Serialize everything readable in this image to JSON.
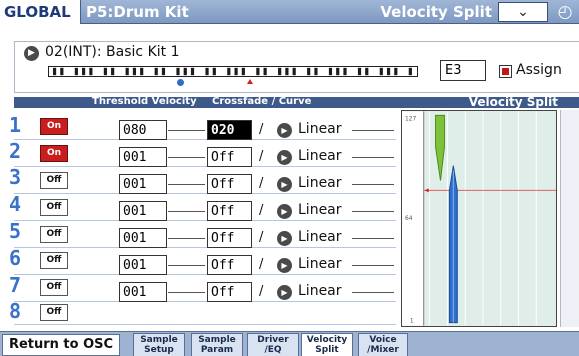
{
  "header": {
    "mode": "GLOBAL",
    "page": "P5:Drum Kit",
    "title": "Velocity Split",
    "menu_icon": "chevron-down-icon",
    "clock_icon": "clock-icon"
  },
  "program": {
    "name": "02(INT): Basic Kit 1",
    "note": "E3",
    "assign_label": "Assign",
    "assign_checked": true
  },
  "columns": {
    "threshold": "Threshold Velocity",
    "crossfade": "Crossfade / Curve",
    "graph": "Velocity Split"
  },
  "rows": [
    {
      "num": "1",
      "state": "On",
      "threshold": "080",
      "crossfade": "020",
      "slash": "/",
      "curve": "Linear"
    },
    {
      "num": "2",
      "state": "On",
      "threshold": "001",
      "crossfade": "Off",
      "slash": "/",
      "curve": "Linear"
    },
    {
      "num": "3",
      "state": "Off",
      "threshold": "001",
      "crossfade": "Off",
      "slash": "/",
      "curve": "Linear"
    },
    {
      "num": "4",
      "state": "Off",
      "threshold": "001",
      "crossfade": "Off",
      "slash": "/",
      "curve": "Linear"
    },
    {
      "num": "5",
      "state": "Off",
      "threshold": "001",
      "crossfade": "Off",
      "slash": "/",
      "curve": "Linear"
    },
    {
      "num": "6",
      "state": "Off",
      "threshold": "001",
      "crossfade": "Off",
      "slash": "/",
      "curve": "Linear"
    },
    {
      "num": "7",
      "state": "Off",
      "threshold": "001",
      "crossfade": "Off",
      "slash": "/",
      "curve": "Linear"
    },
    {
      "num": "8",
      "state": "Off"
    }
  ],
  "graph_axis": {
    "top": "127",
    "mid": "64",
    "bottom": "1"
  },
  "tabs": {
    "return": "Return to OSC",
    "items": [
      {
        "l1": "Sample",
        "l2": "Setup"
      },
      {
        "l1": "Sample",
        "l2": "Param"
      },
      {
        "l1": "Driver",
        "l2": "/EQ"
      },
      {
        "l1": "Velocity",
        "l2": "Split",
        "active": true
      },
      {
        "l1": "Voice",
        "l2": "/Mixer"
      }
    ]
  },
  "colors": {
    "accent": "#3a72c8",
    "on": "#c81e1e",
    "header": "#7e98c2"
  }
}
